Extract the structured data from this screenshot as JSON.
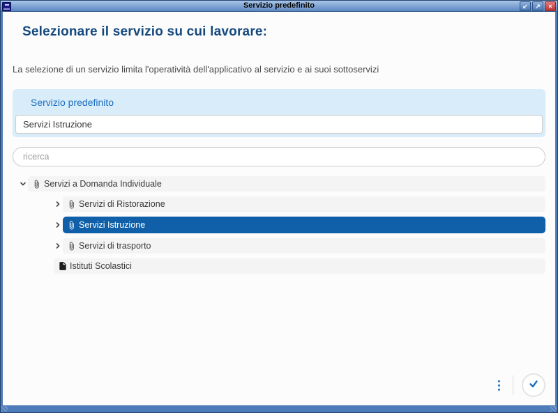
{
  "window": {
    "title": "Servizio predefinito",
    "controls": {
      "minimize_glyph": "↙",
      "maximize_glyph": "↗",
      "close_glyph": "×"
    }
  },
  "page": {
    "heading": "Selezionare il servizio su cui lavorare:",
    "description": "La selezione di un servizio limita l'operatività dell'applicativo al servizio e ai suoi sottoservizi"
  },
  "default_service": {
    "label": "Servizio predefinito",
    "value": "Servizi Istruzione"
  },
  "search": {
    "placeholder": "ricerca"
  },
  "tree": {
    "items": [
      {
        "label": "Servizi a Domanda Individuale",
        "level": 1,
        "state": "expanded",
        "icon": "paperclip",
        "selected": false
      },
      {
        "label": "Servizi di Ristorazione",
        "level": 2,
        "state": "collapsed",
        "icon": "paperclip",
        "selected": false
      },
      {
        "label": "Servizi Istruzione",
        "level": 2,
        "state": "collapsed",
        "icon": "paperclip",
        "selected": true
      },
      {
        "label": "Servizi di trasporto",
        "level": 2,
        "state": "collapsed",
        "icon": "paperclip",
        "selected": false
      },
      {
        "label": "Istituti Scolastici",
        "level": 2,
        "state": "leaf",
        "icon": "document-filled",
        "selected": false
      }
    ]
  },
  "footer": {
    "more_icon": "kebab-vertical",
    "confirm_icon": "check"
  },
  "colors": {
    "accent_blue": "#1b6fc1",
    "selected_row": "#0f60a8",
    "panel_background": "#d9ecf9",
    "heading_navy": "#15497e",
    "window_border": "#4e7bb9",
    "titlebar_top": "#aac5e6",
    "titlebar_bottom": "#5d86c2",
    "close_red": "#bb3535",
    "row_gray": "#f4f4f4"
  }
}
